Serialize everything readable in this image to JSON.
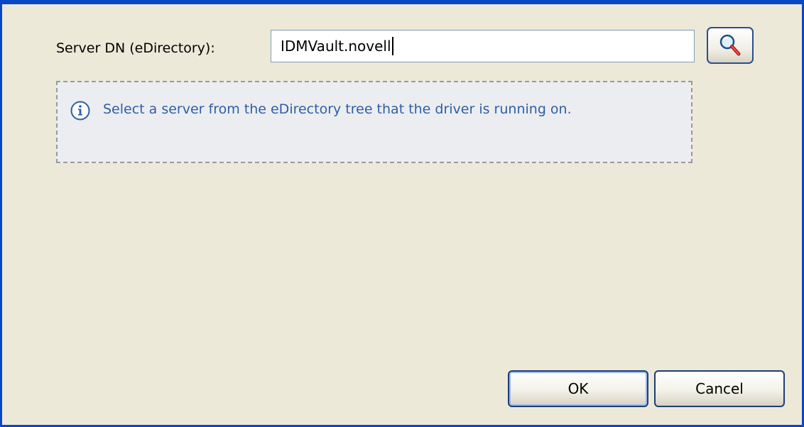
{
  "form": {
    "server_dn_label": "Server DN (eDirectory):",
    "server_dn_value": "IDMVault.novell"
  },
  "browse": {
    "icon": "search-icon"
  },
  "info": {
    "icon": "info-icon",
    "text": "Select a server from the eDirectory tree that the driver is running on."
  },
  "buttons": {
    "ok_label": "OK",
    "cancel_label": "Cancel"
  },
  "colors": {
    "window_border": "#0a47c2",
    "background": "#ece9d8",
    "info_text": "#2c5fa8"
  }
}
